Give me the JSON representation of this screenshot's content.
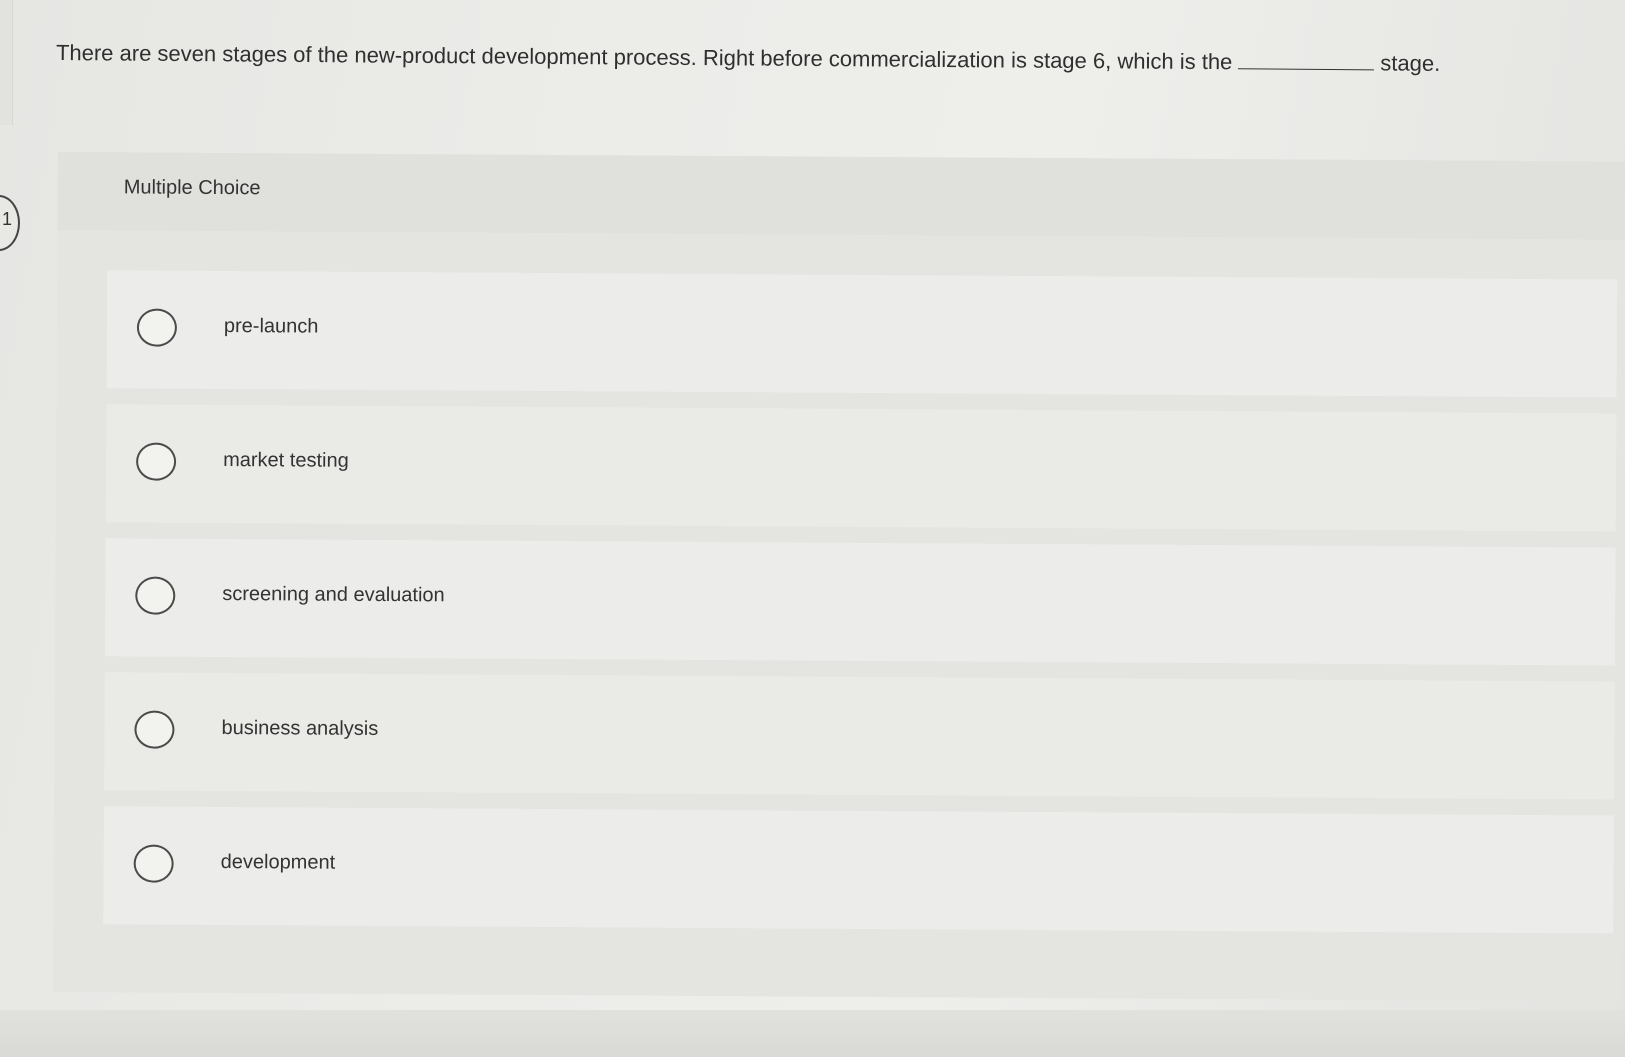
{
  "question": {
    "text_before_blank": "There are seven stages of the new-product development process. Right before commercialization is stage 6, which is the",
    "text_after_blank": "stage."
  },
  "panel": {
    "header_label": "Multiple Choice"
  },
  "side_marker": {
    "label": "1"
  },
  "choices": [
    {
      "label": "pre-launch"
    },
    {
      "label": "market testing"
    },
    {
      "label": "screening and evaluation"
    },
    {
      "label": "business analysis"
    },
    {
      "label": "development"
    }
  ],
  "icons": {
    "radio": "radio-unselected-icon"
  }
}
